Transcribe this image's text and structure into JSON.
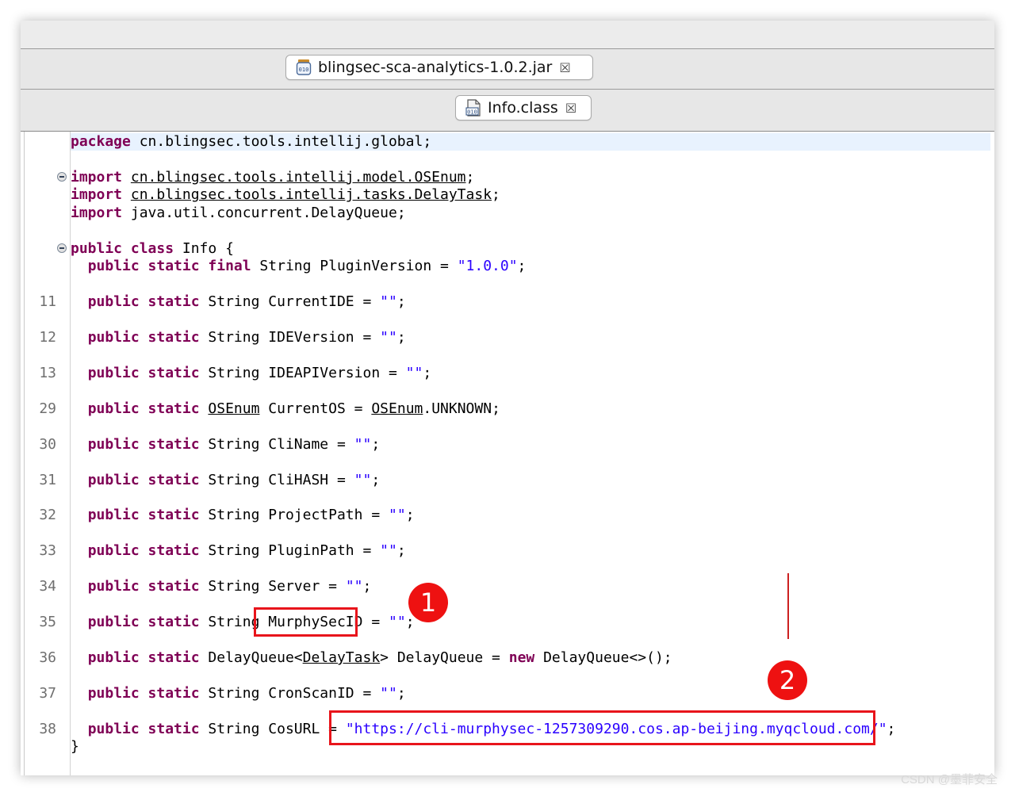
{
  "tabs": {
    "jar_label": "blingsec-sca-analytics-1.0.2.jar",
    "class_label": "Info.class",
    "close_glyph": "☒"
  },
  "editor": {
    "lines": [
      {
        "ln": "",
        "tokens": [
          {
            "t": "package",
            "c": "kw"
          },
          {
            "t": " cn.blingsec.tools.intellij.global;"
          }
        ]
      },
      {
        "ln": "",
        "tokens": []
      },
      {
        "ln": "",
        "fold": true,
        "tokens": [
          {
            "t": "import",
            "c": "kw"
          },
          {
            "t": " "
          },
          {
            "t": "cn.blingsec.tools.intellij.model.OSEnum",
            "c": "u"
          },
          {
            "t": ";"
          }
        ]
      },
      {
        "ln": "",
        "tokens": [
          {
            "t": "import",
            "c": "kw"
          },
          {
            "t": " "
          },
          {
            "t": "cn.blingsec.tools.intellij.tasks.DelayTask",
            "c": "u"
          },
          {
            "t": ";"
          }
        ]
      },
      {
        "ln": "",
        "tokens": [
          {
            "t": "import",
            "c": "kw"
          },
          {
            "t": " java.util.concurrent.DelayQueue;"
          }
        ]
      },
      {
        "ln": "",
        "tokens": []
      },
      {
        "ln": "",
        "fold": true,
        "tokens": [
          {
            "t": "public class",
            "c": "kw"
          },
          {
            "t": " Info {"
          }
        ]
      },
      {
        "ln": "",
        "tokens": [
          {
            "t": "  "
          },
          {
            "t": "public static final",
            "c": "kw"
          },
          {
            "t": " String PluginVersion = "
          },
          {
            "t": "\"1.0.0\"",
            "c": "str"
          },
          {
            "t": ";"
          }
        ]
      },
      {
        "ln": "",
        "tokens": []
      },
      {
        "ln": "11",
        "tokens": [
          {
            "t": "  "
          },
          {
            "t": "public static",
            "c": "kw"
          },
          {
            "t": " String CurrentIDE = "
          },
          {
            "t": "\"\"",
            "c": "str"
          },
          {
            "t": ";"
          }
        ]
      },
      {
        "ln": "",
        "tokens": []
      },
      {
        "ln": "12",
        "tokens": [
          {
            "t": "  "
          },
          {
            "t": "public static",
            "c": "kw"
          },
          {
            "t": " String IDEVersion = "
          },
          {
            "t": "\"\"",
            "c": "str"
          },
          {
            "t": ";"
          }
        ]
      },
      {
        "ln": "",
        "tokens": []
      },
      {
        "ln": "13",
        "tokens": [
          {
            "t": "  "
          },
          {
            "t": "public static",
            "c": "kw"
          },
          {
            "t": " String IDEAPIVersion = "
          },
          {
            "t": "\"\"",
            "c": "str"
          },
          {
            "t": ";"
          }
        ]
      },
      {
        "ln": "",
        "tokens": []
      },
      {
        "ln": "29",
        "tokens": [
          {
            "t": "  "
          },
          {
            "t": "public static",
            "c": "kw"
          },
          {
            "t": " "
          },
          {
            "t": "OSEnum",
            "c": "u"
          },
          {
            "t": " CurrentOS = "
          },
          {
            "t": "OSEnum",
            "c": "u"
          },
          {
            "t": ".UNKNOWN;"
          }
        ]
      },
      {
        "ln": "",
        "tokens": []
      },
      {
        "ln": "30",
        "tokens": [
          {
            "t": "  "
          },
          {
            "t": "public static",
            "c": "kw"
          },
          {
            "t": " String CliName = "
          },
          {
            "t": "\"\"",
            "c": "str"
          },
          {
            "t": ";"
          }
        ]
      },
      {
        "ln": "",
        "tokens": []
      },
      {
        "ln": "31",
        "tokens": [
          {
            "t": "  "
          },
          {
            "t": "public static",
            "c": "kw"
          },
          {
            "t": " String CliHASH = "
          },
          {
            "t": "\"\"",
            "c": "str"
          },
          {
            "t": ";"
          }
        ]
      },
      {
        "ln": "",
        "tokens": []
      },
      {
        "ln": "32",
        "tokens": [
          {
            "t": "  "
          },
          {
            "t": "public static",
            "c": "kw"
          },
          {
            "t": " String ProjectPath = "
          },
          {
            "t": "\"\"",
            "c": "str"
          },
          {
            "t": ";"
          }
        ]
      },
      {
        "ln": "",
        "tokens": []
      },
      {
        "ln": "33",
        "tokens": [
          {
            "t": "  "
          },
          {
            "t": "public static",
            "c": "kw"
          },
          {
            "t": " String PluginPath = "
          },
          {
            "t": "\"\"",
            "c": "str"
          },
          {
            "t": ";"
          }
        ]
      },
      {
        "ln": "",
        "tokens": []
      },
      {
        "ln": "34",
        "tokens": [
          {
            "t": "  "
          },
          {
            "t": "public static",
            "c": "kw"
          },
          {
            "t": " String Server = "
          },
          {
            "t": "\"\"",
            "c": "str"
          },
          {
            "t": ";"
          }
        ]
      },
      {
        "ln": "",
        "tokens": []
      },
      {
        "ln": "35",
        "tokens": [
          {
            "t": "  "
          },
          {
            "t": "public static",
            "c": "kw"
          },
          {
            "t": " String MurphySecID = "
          },
          {
            "t": "\"\"",
            "c": "str"
          },
          {
            "t": ";"
          }
        ]
      },
      {
        "ln": "",
        "tokens": []
      },
      {
        "ln": "36",
        "tokens": [
          {
            "t": "  "
          },
          {
            "t": "public static",
            "c": "kw"
          },
          {
            "t": " DelayQueue<"
          },
          {
            "t": "DelayTask",
            "c": "u"
          },
          {
            "t": "> DelayQueue = "
          },
          {
            "t": "new",
            "c": "kw"
          },
          {
            "t": " DelayQueue<>();"
          }
        ]
      },
      {
        "ln": "",
        "tokens": []
      },
      {
        "ln": "37",
        "tokens": [
          {
            "t": "  "
          },
          {
            "t": "public static",
            "c": "kw"
          },
          {
            "t": " String CronScanID = "
          },
          {
            "t": "\"\"",
            "c": "str"
          },
          {
            "t": ";"
          }
        ]
      },
      {
        "ln": "",
        "tokens": []
      },
      {
        "ln": "38",
        "tokens": [
          {
            "t": "  "
          },
          {
            "t": "public static",
            "c": "kw"
          },
          {
            "t": " String CosURL = "
          },
          {
            "t": "\"https://cli-murphysec-1257309290.cos.ap-beijing.myqcloud.com/\"",
            "c": "str"
          },
          {
            "t": ";"
          }
        ]
      },
      {
        "ln": "",
        "tokens": [
          {
            "t": "}"
          }
        ]
      }
    ]
  },
  "annotations": {
    "badge_1": "1",
    "badge_2": "2",
    "accent_color": "#e8141b"
  },
  "watermark": "CSDN @墨菲安全"
}
